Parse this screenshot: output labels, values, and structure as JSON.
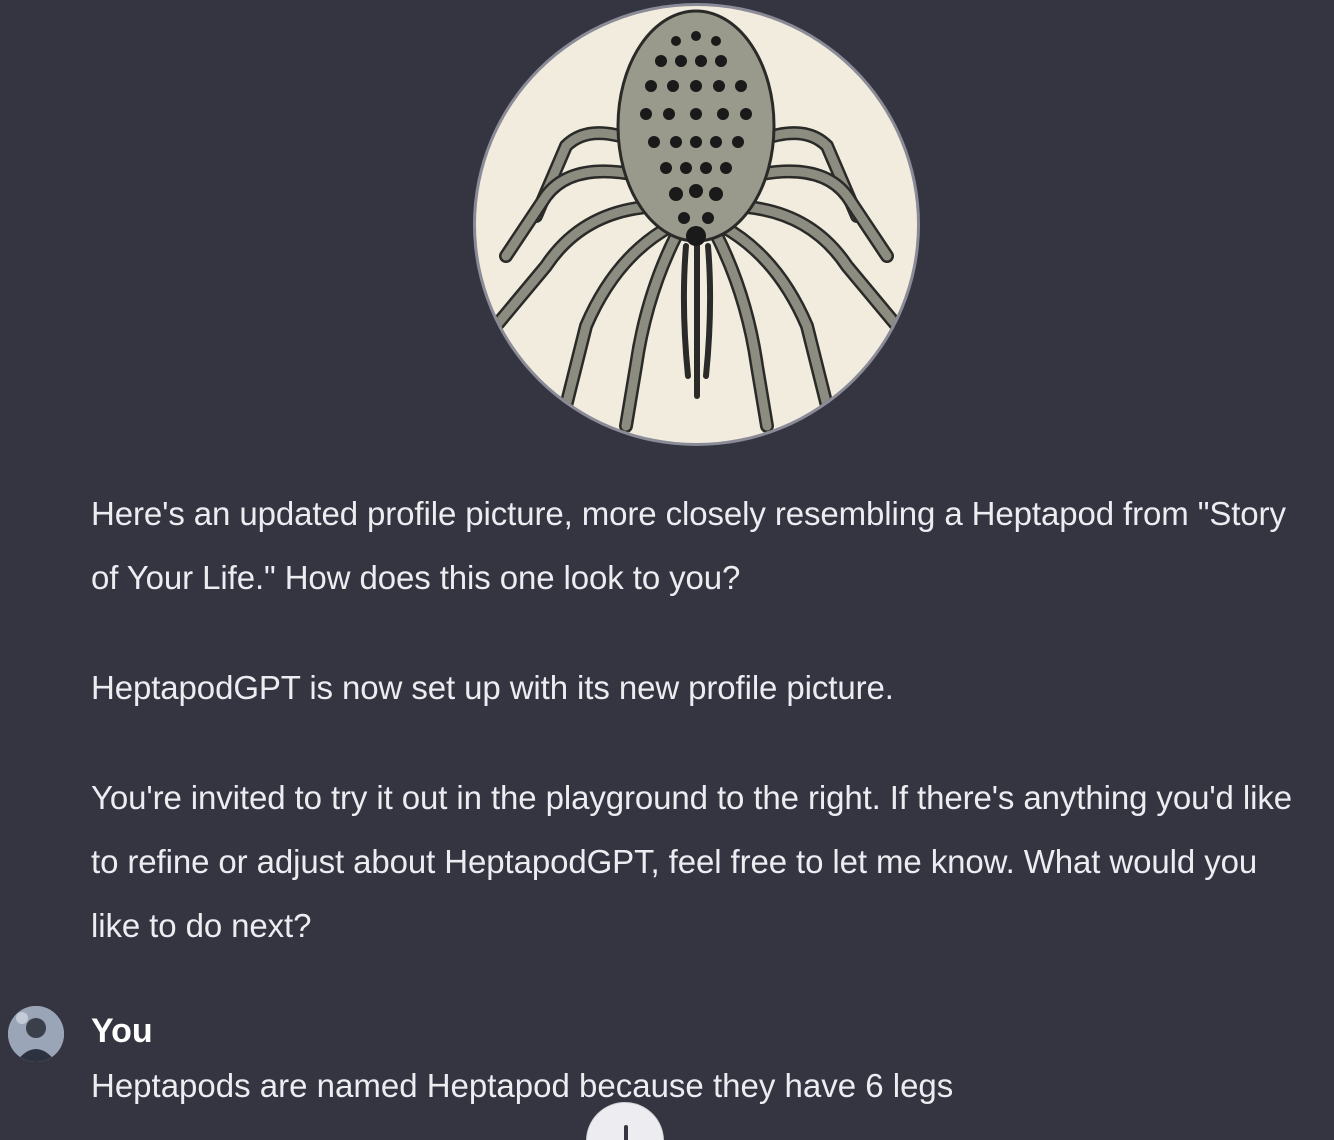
{
  "assistant": {
    "image_alt": "HeptapodGPT profile picture",
    "paragraphs": [
      "Here's an updated profile picture, more closely resembling a Heptapod from \"Story of Your Life.\" How does this one look to you?",
      "HeptapodGPT is now set up with its new profile picture.",
      "You're invited to try it out in the playground to the right. If there's anything you'd like to refine or adjust about HeptapodGPT, feel free to let me know. What would you like to do next?"
    ]
  },
  "user": {
    "name": "You",
    "message": "Heptapods are named Heptapod because they have 6 legs"
  },
  "icons": {
    "scroll_down": "arrow-down-icon",
    "avatar": "user-avatar"
  },
  "colors": {
    "background": "#343541",
    "text": "#ececf1",
    "image_bg": "#f2ecdf"
  }
}
